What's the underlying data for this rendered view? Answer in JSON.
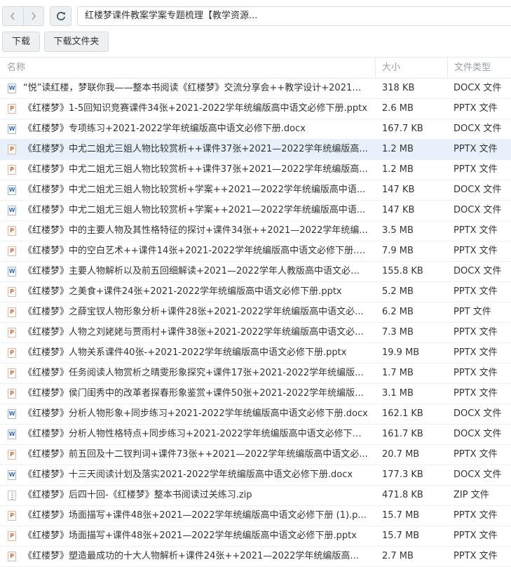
{
  "toolbar": {
    "path": "红楼梦课件教案学案专题梳理【教学资源...",
    "download_label": "下载",
    "download_folder_label": "下载文件夹"
  },
  "columns": {
    "name": "名称",
    "size": "大小",
    "type": "文件类型"
  },
  "files": [
    {
      "icon": "docx",
      "name": "“悦”读红楼，梦联你我——整本书阅读《红楼梦》交流分享会++教学设计+2021—...",
      "size": "318 KB",
      "type": "DOCX 文件"
    },
    {
      "icon": "pptx",
      "name": "《红楼梦》1-5回知识竞赛课件34张+2021-2022学年统编版高中语文必修下册.pptx",
      "size": "2.6 MB",
      "type": "PPTX 文件"
    },
    {
      "icon": "docx",
      "name": "《红楼梦》专项练习+2021-2022学年统编版高中语文必修下册.docx",
      "size": "167.7 KB",
      "type": "DOCX 文件"
    },
    {
      "icon": "pptx",
      "name": "《红楼梦》中尤二姐尤三姐人物比较赏析++课件37张+2021—2022学年统编版高...",
      "size": "1.2 MB",
      "type": "PPTX 文件",
      "selected": true
    },
    {
      "icon": "pptx",
      "name": "《红楼梦》中尤二姐尤三姐人物比较赏析++课件37张+2021—2022学年统编版高...",
      "size": "1.2 MB",
      "type": "PPTX 文件"
    },
    {
      "icon": "docx",
      "name": "《红楼梦》中尤二姐尤三姐人物比较赏析+学案++2021—2022学年统编版高中语...",
      "size": "147 KB",
      "type": "DOCX 文件"
    },
    {
      "icon": "docx",
      "name": "《红楼梦》中尤二姐尤三姐人物比较赏析+学案++2021—2022学年统编版高中语...",
      "size": "147 KB",
      "type": "DOCX 文件"
    },
    {
      "icon": "pptx",
      "name": "《红楼梦》中的主要人物及其性格特征的探讨+课件34张++2021—2022学年统编...",
      "size": "3.5 MB",
      "type": "PPTX 文件"
    },
    {
      "icon": "pptx",
      "name": "《红楼梦》中的空白艺术++课件14张+2021-2022学年统编版高中语文必修下册.p...",
      "size": "7.9 MB",
      "type": "PPTX 文件"
    },
    {
      "icon": "docx",
      "name": "《红楼梦》主要人物解析以及前五回细解读+2021—2022学年人教版高中语文必修...",
      "size": "155.8 KB",
      "type": "DOCX 文件"
    },
    {
      "icon": "pptx",
      "name": "《红楼梦》之美食+课件24张+2021-2022学年统编版高中语文必修下册.pptx",
      "size": "5.2 MB",
      "type": "PPTX 文件"
    },
    {
      "icon": "pptx",
      "name": "《红楼梦》之薛宝钗人物形象分析+课件28张+2021-2022学年统编版高中语文必...",
      "size": "6.2 MB",
      "type": "PPT 文件"
    },
    {
      "icon": "pptx",
      "name": "《红楼梦》人物之刘姥姥与贾雨村+课件38张+2021-2022学年统编版高中语文必...",
      "size": "7.3 MB",
      "type": "PPTX 文件"
    },
    {
      "icon": "pptx",
      "name": "《红楼梦》人物关系课件40张-+2021-2022学年统编版高中语文必修下册.pptx",
      "size": "19.9 MB",
      "type": "PPTX 文件"
    },
    {
      "icon": "pptx",
      "name": "《红楼梦》任务阅读人物赏析之晴雯形象探究+课件17张+2021-2022学年统编版...",
      "size": "1.7 MB",
      "type": "PPTX 文件"
    },
    {
      "icon": "pptx",
      "name": "《红楼梦》侯门闺秀中的改革者探春形象鉴赏+课件50张+2021-2022学年统编版...",
      "size": "3.1 MB",
      "type": "PPTX 文件"
    },
    {
      "icon": "docx",
      "name": "《红楼梦》分析人物形象+同步练习+2021-2022学年统编版高中语文必修下册.docx",
      "size": "162.1 KB",
      "type": "DOCX 文件"
    },
    {
      "icon": "docx",
      "name": "《红楼梦》分析人物性格特点+同步练习+2021-2022学年统编版高中语文必修下册...",
      "size": "161.7 KB",
      "type": "DOCX 文件"
    },
    {
      "icon": "pptx",
      "name": "《红楼梦》前五回及十二钗判词+课件73张++2021—2022学年统编版高中语文必...",
      "size": "20.7 MB",
      "type": "PPTX 文件"
    },
    {
      "icon": "docx",
      "name": "《红楼梦》十三天阅读计划及落实2021-2022学年统编版高中语文必修下册.docx",
      "size": "177.3 KB",
      "type": "DOCX 文件"
    },
    {
      "icon": "zip",
      "name": "《红楼梦》后四十回-《红楼梦》整本书阅读过关练习.zip",
      "size": "471.8 KB",
      "type": "ZIP 文件"
    },
    {
      "icon": "pptx",
      "name": "《红楼梦》场面描写+课件48张+2021—2022学年统编版高中语文必修下册 (1).p...",
      "size": "15.7 MB",
      "type": "PPTX 文件"
    },
    {
      "icon": "pptx",
      "name": "《红楼梦》场面描写+课件48张+2021—2022学年统编版高中语文必修下册.pptx",
      "size": "15.7 MB",
      "type": "PPTX 文件"
    },
    {
      "icon": "pptx",
      "name": "《红楼梦》塑造最成功的十大人物解析+课件24张++2021—2022学年统编版高中语...",
      "size": "2.7 MB",
      "type": "PPTX 文件"
    }
  ]
}
